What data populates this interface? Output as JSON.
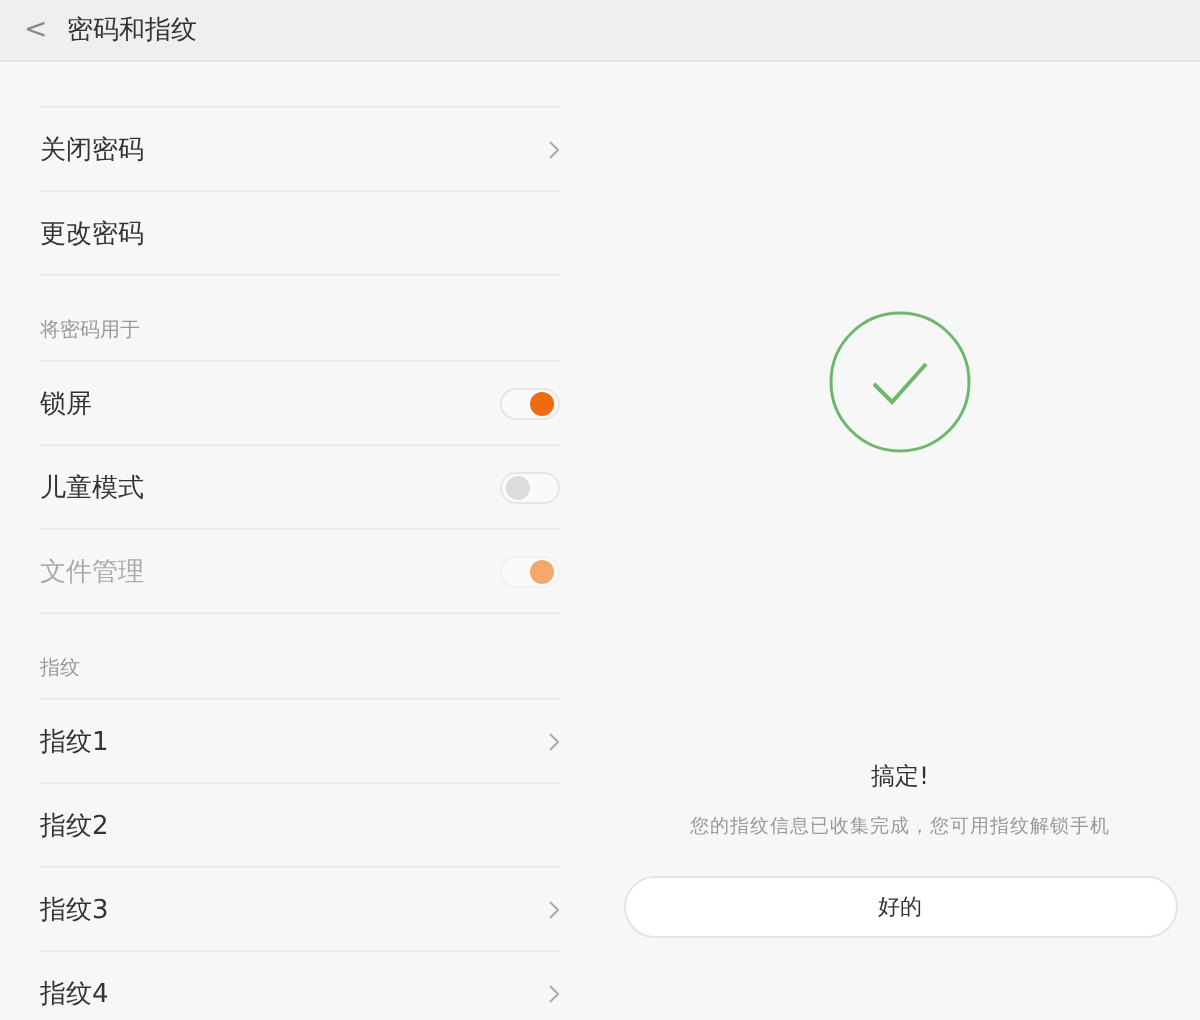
{
  "header": {
    "back": "<",
    "title": "密码和指纹"
  },
  "sections": [
    {
      "items": [
        {
          "kind": "link",
          "label": "关闭密码"
        },
        {
          "kind": "plain",
          "label": "更改密码"
        }
      ]
    },
    {
      "title": "将密码用于",
      "items": [
        {
          "kind": "toggle",
          "label": "锁屏",
          "on": true,
          "disabled": false
        },
        {
          "kind": "toggle",
          "label": "儿童模式",
          "on": false,
          "disabled": false
        },
        {
          "kind": "toggle",
          "label": "文件管理",
          "on": true,
          "disabled": true
        }
      ]
    },
    {
      "title": "指纹",
      "items": [
        {
          "kind": "link",
          "label": "指纹1"
        },
        {
          "kind": "plain",
          "label": "指纹2"
        },
        {
          "kind": "link",
          "label": "指纹3"
        },
        {
          "kind": "link",
          "label": "指纹4"
        }
      ]
    }
  ],
  "result": {
    "title": "搞定!",
    "message": "您的指纹信息已收集完成，您可用指纹解锁手机",
    "button": "好的"
  }
}
